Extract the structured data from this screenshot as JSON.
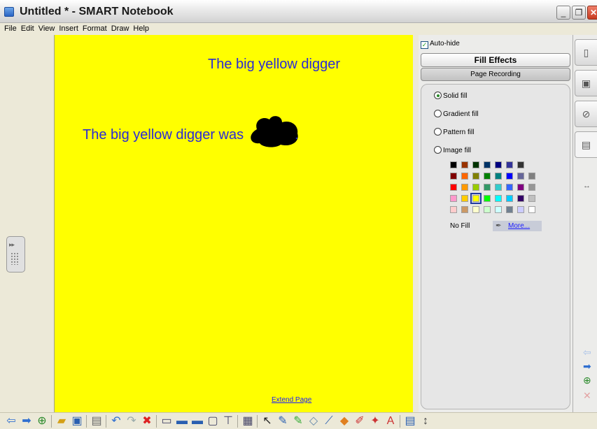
{
  "window": {
    "title": "Untitled * - SMART Notebook"
  },
  "menu": [
    "File",
    "Edit",
    "View",
    "Insert",
    "Format",
    "Draw",
    "Help"
  ],
  "page": {
    "heading": "The big yellow digger",
    "sentence": "The big yellow digger was",
    "sentence_end": ".",
    "extend_link": "Extend Page",
    "background_color": "#ffff00",
    "text_color": "#2b2bd5"
  },
  "panel": {
    "auto_hide_label": "Auto-hide",
    "auto_hide_checked": true,
    "fill_effects_label": "Fill Effects",
    "page_recording_label": "Page Recording",
    "fill_options": [
      {
        "label": "Solid fill",
        "selected": true
      },
      {
        "label": "Gradient fill",
        "selected": false
      },
      {
        "label": "Pattern fill",
        "selected": false
      },
      {
        "label": "Image fill",
        "selected": false
      }
    ],
    "palette_colors": [
      [
        "#000000",
        "#993300",
        "#003300",
        "#003366",
        "#000080",
        "#333399",
        "#333333"
      ],
      [
        "#800000",
        "#ff6600",
        "#808000",
        "#008000",
        "#008080",
        "#0000ff",
        "#666699",
        "#808080"
      ],
      [
        "#ff0000",
        "#ff9900",
        "#99cc00",
        "#339966",
        "#33cccc",
        "#3366ff",
        "#800080",
        "#969696"
      ],
      [
        "#ff99cc",
        "#ffcc00",
        "#ffff00",
        "#00ff00",
        "#00ffff",
        "#00ccff",
        "#330066",
        "#c0c0c0"
      ],
      [
        "#ffcccc",
        "#cc9966",
        "#ffffcc",
        "#ccffcc",
        "#ccffff",
        "#708090",
        "#ccccff",
        "#ffffff"
      ]
    ],
    "selected_color": "#ffff00",
    "no_fill_label": "No Fill",
    "more_label": "More..."
  },
  "side_tabs": [
    "page-sorter-icon",
    "gallery-icon",
    "attachments-icon",
    "properties-icon"
  ],
  "toolbar_icons": [
    "back-arrow-icon",
    "forward-arrow-icon",
    "add-page-icon",
    "sep",
    "open-folder-icon",
    "save-icon",
    "sep",
    "paste-icon",
    "sep",
    "undo-icon",
    "redo-icon",
    "delete-icon",
    "sep",
    "screen-shade-icon",
    "full-screen-icon",
    "dual-page-icon",
    "screen-capture-icon",
    "document-camera-icon",
    "sep",
    "table-icon",
    "sep",
    "select-icon",
    "pen-icon",
    "creative-pen-icon",
    "eraser-icon",
    "line-icon",
    "shape-icon",
    "magic-pen-icon",
    "fill-icon",
    "text-icon",
    "sep",
    "properties-icon",
    "more-icon"
  ]
}
